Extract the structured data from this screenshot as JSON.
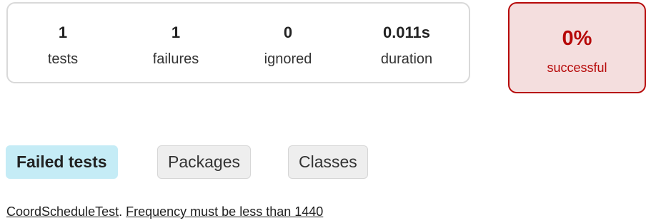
{
  "summary": {
    "counters": [
      {
        "id": "tests",
        "value": "1",
        "label": "tests"
      },
      {
        "id": "failures",
        "value": "1",
        "label": "failures"
      },
      {
        "id": "ignored",
        "value": "0",
        "label": "ignored"
      },
      {
        "id": "duration",
        "value": "0.011s",
        "label": "duration"
      }
    ],
    "success_rate": {
      "value": "0%",
      "label": "successful",
      "color": "#b60808",
      "background": "#f4dede"
    }
  },
  "tabs": [
    {
      "label": "Failed tests",
      "active": true
    },
    {
      "label": "Packages",
      "active": false
    },
    {
      "label": "Classes",
      "active": false
    }
  ],
  "failed_tests": [
    {
      "class_name": "CoordScheduleTest",
      "separator": ". ",
      "test_name": "Frequency must be less than 1440"
    }
  ],
  "colors": {
    "active_tab": "#c5ecf6",
    "inactive_tab": "#eeeeee",
    "failure": "#b60808"
  }
}
